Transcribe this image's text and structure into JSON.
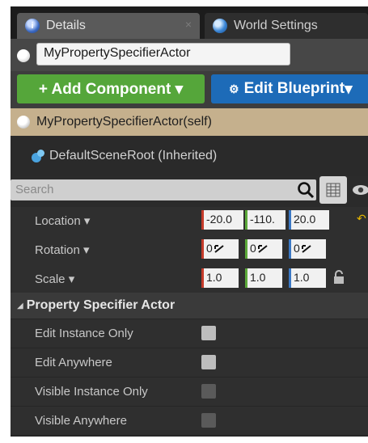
{
  "tabs": [
    {
      "label": "Details",
      "icon": "details-icon",
      "close": "×"
    },
    {
      "label": "World Settings",
      "icon": "globe-icon"
    }
  ],
  "actor_name": "MyPropertySpecifierActor",
  "buttons": {
    "add_component": "+ Add Component ▾",
    "edit_blueprint": "Edit Blueprint",
    "edit_blueprint_arrow": "▾"
  },
  "components": [
    {
      "label": "MyPropertySpecifierActor(self)",
      "icon": "actor-icon"
    },
    {
      "label": "DefaultSceneRoot (Inherited)",
      "icon": "scene-root-icon"
    }
  ],
  "search": {
    "placeholder": "Search"
  },
  "transform": {
    "location": {
      "label": "Location ▾",
      "x": "-20.0",
      "y": "-110.",
      "z": "20.0"
    },
    "rotation": {
      "label": "Rotation ▾",
      "x": "0",
      "y": "0",
      "z": "0"
    },
    "scale": {
      "label": "Scale ▾",
      "x": "1.0",
      "y": "1.0",
      "z": "1.0"
    }
  },
  "category": {
    "title": "Property Specifier Actor"
  },
  "properties": [
    {
      "label": "Edit Instance Only",
      "enabled": true
    },
    {
      "label": "Edit Anywhere",
      "enabled": true
    },
    {
      "label": "Visible Instance Only",
      "enabled": false
    },
    {
      "label": "Visible Anywhere",
      "enabled": false
    }
  ],
  "colors": {
    "add_button": "#55a63a",
    "blueprint_button": "#1d6bb8",
    "selected_component": "#c5b08d",
    "axis_x": "#c53b2a",
    "axis_y": "#5ba83a",
    "axis_z": "#3a78c4"
  }
}
